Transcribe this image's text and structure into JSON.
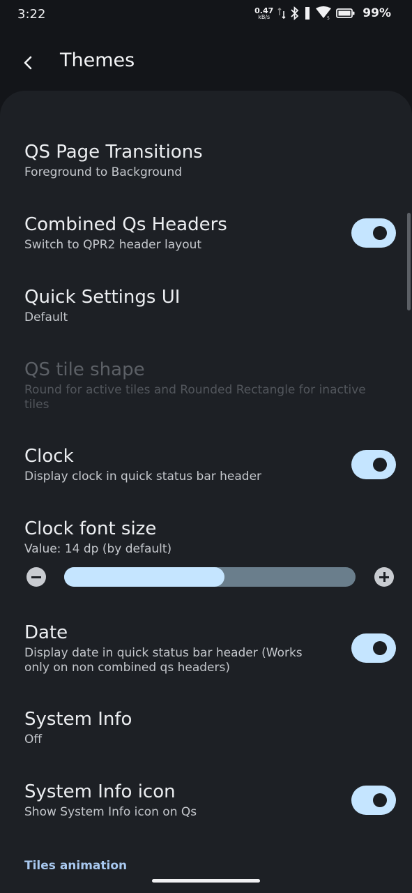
{
  "status_bar": {
    "time": "3:22",
    "net_speed": "0.47",
    "net_unit": "kB/s",
    "battery": "99%",
    "icons": [
      "data-arrows-icon",
      "bluetooth-icon",
      "signal-icon",
      "wifi-icon",
      "battery-icon"
    ]
  },
  "app_bar": {
    "title": "Themes",
    "back_icon": "back-arrow-icon"
  },
  "settings": [
    {
      "title": "QS Page Transitions",
      "summary": "Foreground to Background"
    },
    {
      "title": "Combined Qs Headers",
      "summary": "Switch to QPR2 header layout",
      "toggle": true
    },
    {
      "title": "Quick Settings UI",
      "summary": "Default"
    },
    {
      "title": "QS tile shape",
      "summary": "Round for active tiles and Rounded Rectangle for inactive tiles",
      "disabled": true
    },
    {
      "title": "Clock",
      "summary": "Display clock in quick status bar header",
      "toggle": true
    },
    {
      "title": "Clock font size",
      "summary": "Value: 14 dp (by default)"
    },
    {
      "title": "Date",
      "summary": "Display date in quick status bar header (Works only on non combined qs headers)",
      "toggle": true
    },
    {
      "title": "System Info",
      "summary": "Off"
    },
    {
      "title": "System Info icon",
      "summary": "Show System Info icon on Qs",
      "toggle": true
    }
  ],
  "clock_slider": {
    "fraction": 0.55,
    "minus_icon": "minus-circle-icon",
    "plus_icon": "plus-circle-icon"
  },
  "section_header": "Tiles animation",
  "colors": {
    "accent": "#c5e5ff",
    "background": "#131519",
    "panel": "#1d2025"
  }
}
